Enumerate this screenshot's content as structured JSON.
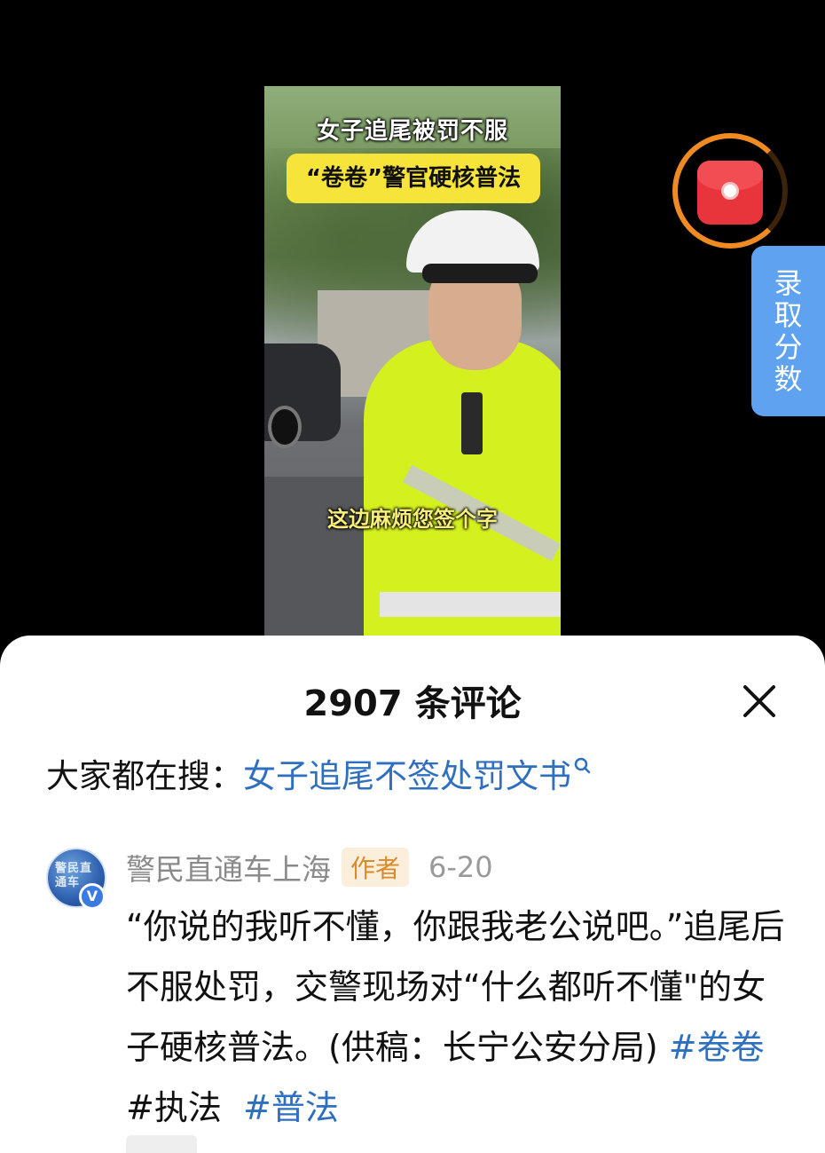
{
  "video": {
    "title": "女子追尾被罚不服",
    "banner": "“卷卷”警官硬核普法",
    "subtitle": "这边麻烦您签个字"
  },
  "side_widget": {
    "chars": [
      "录",
      "取",
      "分",
      "数"
    ],
    "color": "#5fa3f0"
  },
  "red_packet": {
    "icon": "red-envelope-icon",
    "accent": "#f08a22"
  },
  "comments_sheet": {
    "title": "2907 条评论",
    "close_icon": "close-icon",
    "search": {
      "prefix": "大家都在搜：",
      "query": "女子追尾不签处罚文书"
    },
    "comments": [
      {
        "author": "警民直通车上海",
        "author_tag": "作者",
        "date": "6-20",
        "avatar_text": "警民直通车",
        "verified_mark": "V",
        "text": "“你说的我听不懂，你跟我老公说吧。”追尾后不服处罚，交警现场对“什么都听不懂\"的女子硬核普法。(供稿：长宁公安分局)",
        "hashtags": [
          "#卷卷",
          "#执法",
          "#普法"
        ]
      }
    ]
  },
  "colors": {
    "link_blue": "#2f6fbf",
    "tag_bg": "#fbefdc",
    "tag_text": "#d98a2b"
  }
}
